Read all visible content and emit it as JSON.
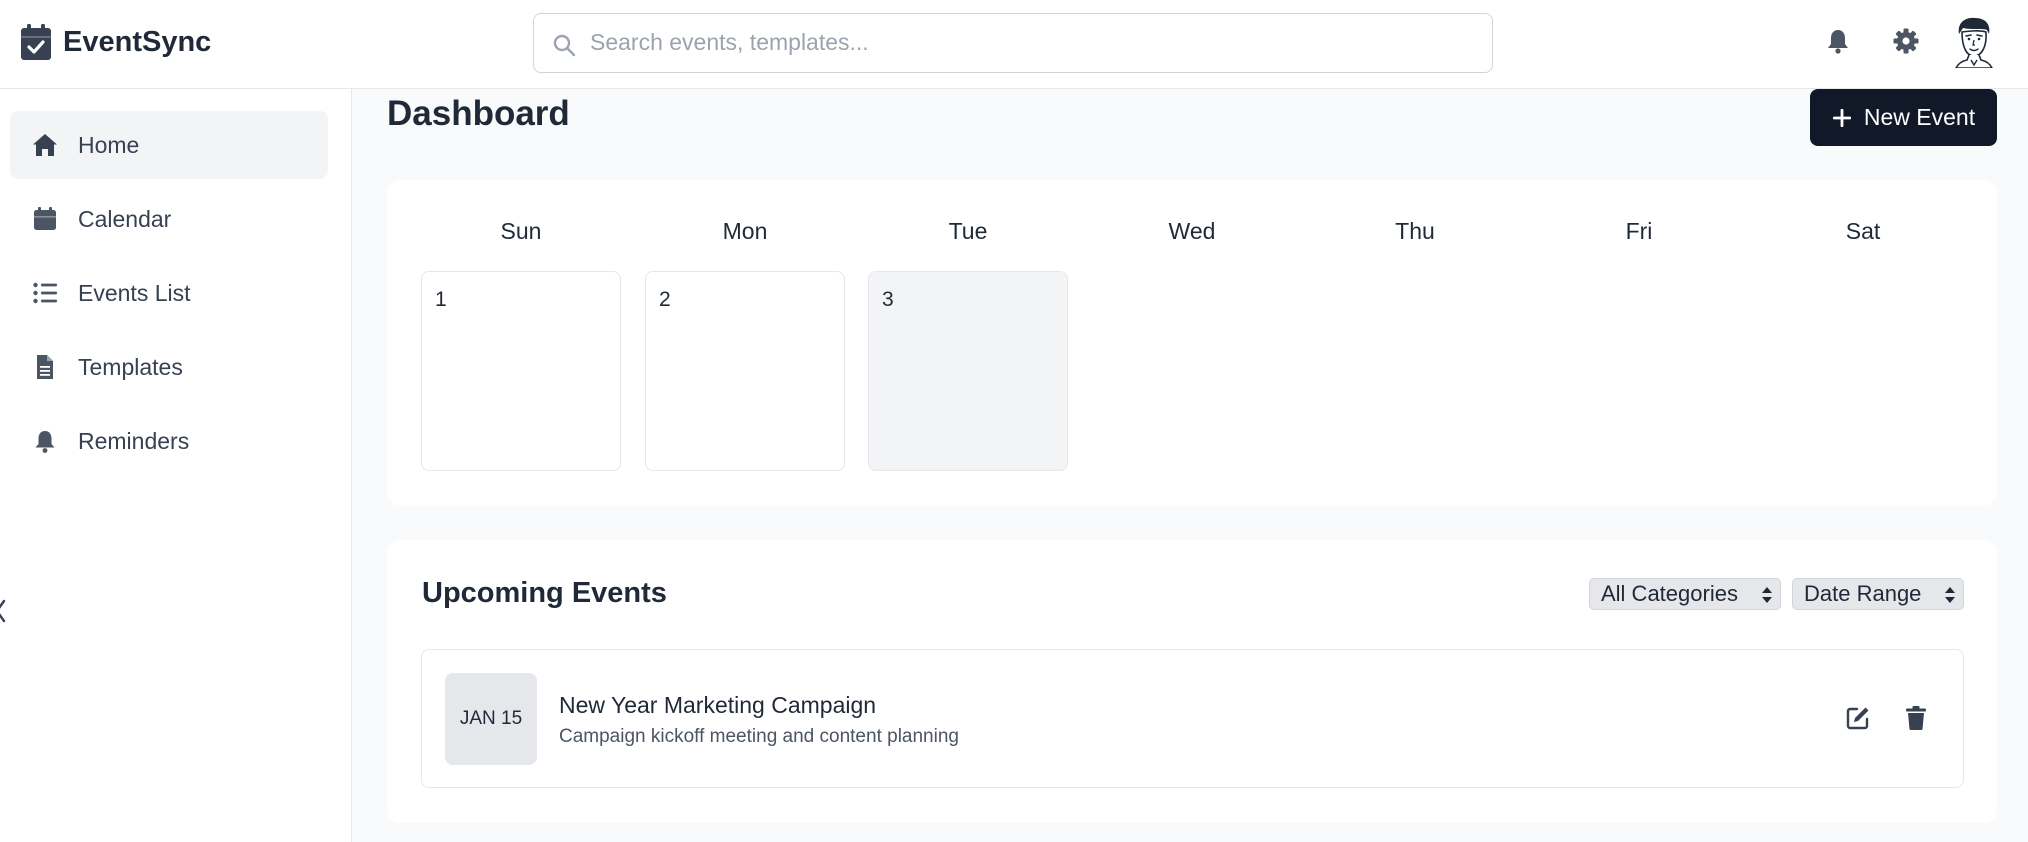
{
  "app": {
    "name": "EventSync"
  },
  "search": {
    "placeholder": "Search events, templates..."
  },
  "header_icons": [
    "bell-icon",
    "gear-icon",
    "avatar"
  ],
  "sidebar": {
    "items": [
      {
        "label": "Home",
        "icon": "home-icon",
        "active": true
      },
      {
        "label": "Calendar",
        "icon": "calendar-icon",
        "active": false
      },
      {
        "label": "Events List",
        "icon": "list-icon",
        "active": false
      },
      {
        "label": "Templates",
        "icon": "file-icon",
        "active": false
      },
      {
        "label": "Reminders",
        "icon": "bell-icon",
        "active": false
      }
    ]
  },
  "main": {
    "title": "Dashboard",
    "new_event_label": "New Event"
  },
  "calendar": {
    "weekdays": [
      "Sun",
      "Mon",
      "Tue",
      "Wed",
      "Thu",
      "Fri",
      "Sat"
    ],
    "days": [
      "1",
      "2",
      "3"
    ],
    "today": "3"
  },
  "upcoming": {
    "title": "Upcoming Events",
    "filters": {
      "category": "All Categories",
      "date": "Date Range"
    },
    "events": [
      {
        "date": "JAN 15",
        "title": "New Year Marketing Campaign",
        "description": "Campaign kickoff meeting and content planning"
      }
    ]
  },
  "colors": {
    "primary_button": "#111827",
    "active_nav": "#f3f4f6",
    "page_background": "#f9fafb",
    "icon": "#4b5563"
  }
}
